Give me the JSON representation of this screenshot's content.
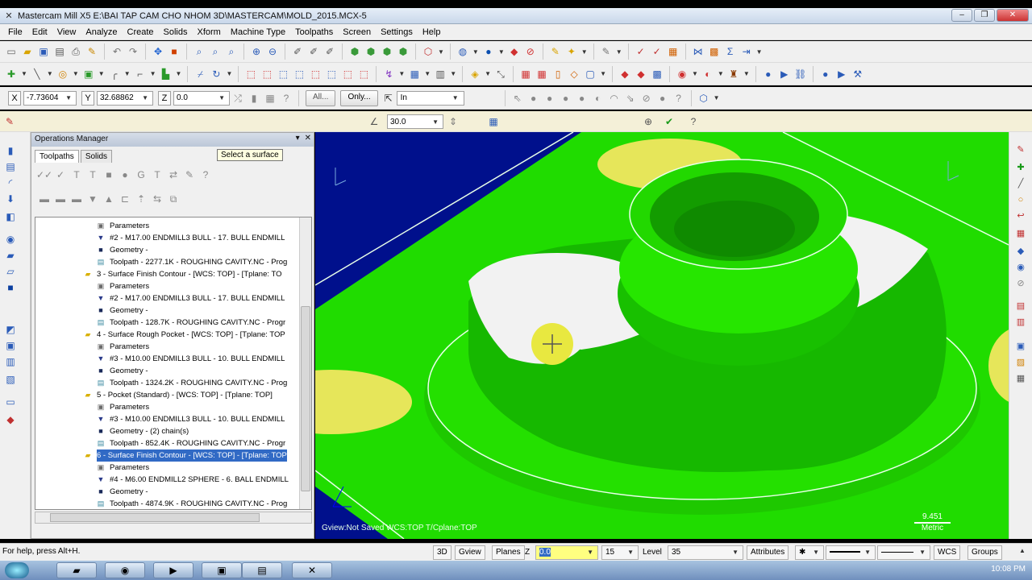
{
  "window": {
    "title": "Mastercam Mill X5  E:\\BAI TAP CAM CHO NHOM 3D\\MASTERCAM\\MOLD_2015.MCX-5",
    "min_label": "–",
    "max_label": "❐",
    "close_label": "✕"
  },
  "menu": [
    "File",
    "Edit",
    "View",
    "Analyze",
    "Create",
    "Solids",
    "Xform",
    "Machine Type",
    "Toolpaths",
    "Screen",
    "Settings",
    "Help"
  ],
  "coords": {
    "x_label": "X",
    "x_value": "-7.73604",
    "y_label": "Y",
    "y_value": "32.68862",
    "z_label": "Z",
    "z_value": "0.0",
    "all_button": "All...",
    "only_button": "Only...",
    "snap_mode": "In"
  },
  "selection_bar": {
    "angle_value": "30.0"
  },
  "ops_manager": {
    "title": "Operations Manager",
    "tabs": [
      "Toolpaths",
      "Solids"
    ],
    "tooltip": "Select a surface",
    "tree": [
      {
        "text": "Parameters",
        "icon": "params-icon",
        "level": 2
      },
      {
        "text": "#2 - M17.00 ENDMILL3 BULL -     17. BULL ENDMILL",
        "icon": "tool-icon",
        "level": 2
      },
      {
        "text": "Geometry -",
        "icon": "geometry-icon",
        "level": 2
      },
      {
        "text": "Toolpath - 2277.1K - ROUGHING CAVITY.NC - Prog",
        "icon": "toolpath-icon",
        "level": 2
      },
      {
        "text": "3 - Surface Finish Contour - [WCS: TOP] - [Tplane: TO",
        "icon": "folder-icon",
        "level": 1
      },
      {
        "text": "Parameters",
        "icon": "params-icon",
        "level": 2
      },
      {
        "text": "#2 - M17.00 ENDMILL3 BULL -     17. BULL ENDMILL",
        "icon": "tool-icon",
        "level": 2
      },
      {
        "text": "Geometry -",
        "icon": "geometry-icon",
        "level": 2
      },
      {
        "text": "Toolpath - 128.7K - ROUGHING CAVITY.NC - Progr",
        "icon": "toolpath-icon",
        "level": 2
      },
      {
        "text": "4 - Surface Rough Pocket - [WCS: TOP] - [Tplane: TOP",
        "icon": "folder-icon",
        "level": 1
      },
      {
        "text": "Parameters",
        "icon": "params-icon",
        "level": 2
      },
      {
        "text": "#3 - M10.00 ENDMILL3 BULL -     10. BULL ENDMILL",
        "icon": "tool-icon",
        "level": 2
      },
      {
        "text": "Geometry -",
        "icon": "geometry-icon",
        "level": 2
      },
      {
        "text": "Toolpath - 1324.2K - ROUGHING CAVITY.NC - Prog",
        "icon": "toolpath-icon",
        "level": 2
      },
      {
        "text": "5 - Pocket (Standard) - [WCS: TOP] - [Tplane: TOP]",
        "icon": "folder-icon",
        "level": 1
      },
      {
        "text": "Parameters",
        "icon": "params-icon",
        "level": 2
      },
      {
        "text": "#3 - M10.00 ENDMILL3 BULL -     10. BULL ENDMILL",
        "icon": "tool-icon",
        "level": 2
      },
      {
        "text": "Geometry - (2) chain(s)",
        "icon": "geometry-icon",
        "level": 2
      },
      {
        "text": "Toolpath - 852.4K - ROUGHING CAVITY.NC - Progr",
        "icon": "toolpath-icon",
        "level": 2
      },
      {
        "text": "6 - Surface Finish Contour - [WCS: TOP] - [Tplane: TOP",
        "icon": "folder-icon",
        "level": 1,
        "selected": true
      },
      {
        "text": "Parameters",
        "icon": "params-icon",
        "level": 2
      },
      {
        "text": "#4 - M6.00 ENDMILL2 SPHERE -     6. BALL ENDMILL",
        "icon": "tool-icon",
        "level": 2
      },
      {
        "text": "Geometry -",
        "icon": "geometry-icon",
        "level": 2
      },
      {
        "text": "Toolpath - 4874.9K - ROUGHING CAVITY.NC - Prog",
        "icon": "toolpath-icon",
        "level": 2
      }
    ]
  },
  "viewport": {
    "status": "Gview:Not Saved   WCS:TOP   T/Cplane:TOP",
    "scale_value": "9.451",
    "scale_unit": "Metric",
    "colors": {
      "background": "#00108c",
      "surface": "#22dd00",
      "selected": "#f2f2f2",
      "highlight": "#e6e65a"
    }
  },
  "statusbar": {
    "help": "For help, press Alt+H.",
    "btn_3d": "3D",
    "btn_gview": "Gview",
    "btn_planes": "Planes",
    "z_label": "Z",
    "z_value": "0.0",
    "depth": "15",
    "level_label": "Level",
    "level_value": "35",
    "attributes": "Attributes",
    "wcs": "WCS",
    "groups": "Groups"
  },
  "taskbar": {
    "clock": "10:08 PM"
  }
}
